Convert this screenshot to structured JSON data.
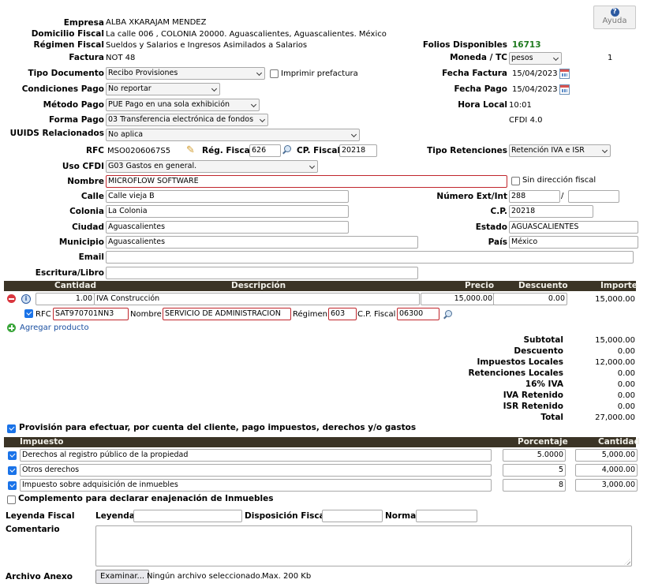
{
  "help": {
    "label": "Ayuda"
  },
  "empresa": {
    "label": "Empresa",
    "value": "ALBA XKARAJAM MENDEZ"
  },
  "domicilio": {
    "label": "Domicilio Fiscal",
    "value": "La calle 006 , COLONIA 20000. Aguascalientes, Aguascalientes. México"
  },
  "regimen": {
    "label": "Régimen Fiscal",
    "value": "Sueldos y Salarios e Ingresos Asimilados a Salarios"
  },
  "factura": {
    "label": "Factura",
    "value": "NOT 48"
  },
  "folios": {
    "label": "Folios Disponibles",
    "value": "16713"
  },
  "moneda": {
    "label": "Moneda / TC",
    "value": "pesos",
    "tc": "1"
  },
  "tipo_documento": {
    "label": "Tipo Documento",
    "value": "Recibo Provisiones"
  },
  "imprimir_prefactura": {
    "label": "Imprimir prefactura"
  },
  "fecha_factura": {
    "label": "Fecha Factura",
    "value": "15/04/2023"
  },
  "condiciones_pago": {
    "label": "Condiciones Pago",
    "value": "No reportar"
  },
  "fecha_pago": {
    "label": "Fecha Pago",
    "value": "15/04/2023"
  },
  "metodo_pago": {
    "label": "Método Pago",
    "value": "PUE Pago en una sola exhibición"
  },
  "hora_local": {
    "label": "Hora Local",
    "value": "10:01"
  },
  "forma_pago": {
    "label": "Forma Pago",
    "value": "03 Transferencia electrónica de fondos"
  },
  "cfdi_version": "CFDI 4.0",
  "uuids": {
    "label": "UUIDS Relacionados",
    "value": "No aplica"
  },
  "rfc": {
    "label": "RFC",
    "value": "MSO0206067S5"
  },
  "reg_fiscal": {
    "label": "Rég. Fiscal",
    "value": "626"
  },
  "cp_fiscal": {
    "label": "CP. Fiscal",
    "value": "20218"
  },
  "tipo_retenciones": {
    "label": "Tipo Retenciones",
    "value": "Retención IVA e ISR"
  },
  "uso_cfdi": {
    "label": "Uso CFDI",
    "value": "G03 Gastos en general."
  },
  "nombre": {
    "label": "Nombre",
    "value": "MICROFLOW SOFTWARE"
  },
  "sin_direccion": {
    "label": "Sin dirección fiscal"
  },
  "calle": {
    "label": "Calle",
    "value": "Calle vieja B"
  },
  "numero": {
    "label": "Número Ext/Int",
    "ext": "288",
    "sep": "/",
    "int": ""
  },
  "colonia": {
    "label": "Colonia",
    "value": "La Colonia"
  },
  "cp": {
    "label": "C.P.",
    "value": "20218"
  },
  "ciudad": {
    "label": "Ciudad",
    "value": "Aguascalientes"
  },
  "estado": {
    "label": "Estado",
    "value": "AGUASCALIENTES"
  },
  "municipio": {
    "label": "Municipio",
    "value": "Aguascalientes"
  },
  "pais": {
    "label": "País",
    "value": "México"
  },
  "email": {
    "label": "Email",
    "value": ""
  },
  "escritura": {
    "label": "Escritura/Libro",
    "value": ""
  },
  "items_header": {
    "cantidad": "Cantidad",
    "descripcion": "Descripción",
    "precio": "Precio",
    "descuento": "Descuento",
    "importe": "Importe"
  },
  "item": {
    "cantidad": "1.00",
    "descripcion": "IVA Construcción",
    "precio": "15,000.00",
    "descuento": "0.00",
    "importe": "15,000.00"
  },
  "tercero": {
    "rfc_label": "RFC",
    "rfc": "SAT970701NN3",
    "nombre_label": "Nombre",
    "nombre": "SERVICIO DE ADMINISTRACION",
    "regimen_label": "Régimen",
    "regimen": "603",
    "cp_label": "C.P. Fiscal",
    "cp": "06300"
  },
  "agregar_producto": "Agregar producto",
  "totals": [
    {
      "label": "Subtotal",
      "value": "15,000.00"
    },
    {
      "label": "Descuento",
      "value": "0.00"
    },
    {
      "label": "Impuestos Locales",
      "value": "12,000.00"
    },
    {
      "label": "Retenciones Locales",
      "value": "0.00"
    },
    {
      "label": "16% IVA",
      "value": "0.00"
    },
    {
      "label": "IVA Retenido",
      "value": "0.00"
    },
    {
      "label": "ISR Retenido",
      "value": "0.00"
    },
    {
      "label": "Total",
      "value": "27,000.00"
    }
  ],
  "provision": {
    "label": "Provisión para efectuar, por cuenta del cliente, pago impuestos, derechos y/o gastos"
  },
  "tax_header": {
    "impuesto": "Impuesto",
    "porcentaje": "Porcentaje",
    "cantidad": "Cantidad"
  },
  "taxes": [
    {
      "name": "Derechos al registro público de la propiedad",
      "pct": "5.0000",
      "amount": "5,000.00"
    },
    {
      "name": "Otros derechos",
      "pct": "5",
      "amount": "4,000.00"
    },
    {
      "name": "Impuesto sobre adquisición de inmuebles",
      "pct": "8",
      "amount": "3,000.00"
    }
  ],
  "complemento": {
    "label": "Complemento para declarar enajenación de Inmuebles"
  },
  "leyenda_fiscal": {
    "label": "Leyenda Fiscal",
    "leyenda_label": "Leyenda",
    "disposicion_label": "Disposición Fiscal",
    "norma_label": "Norma"
  },
  "comentario": {
    "label": "Comentario"
  },
  "archivo": {
    "label": "Archivo Anexo",
    "button": "Examinar...",
    "status": "Ningún archivo seleccionado.",
    "max": "Max. 200 Kb"
  }
}
